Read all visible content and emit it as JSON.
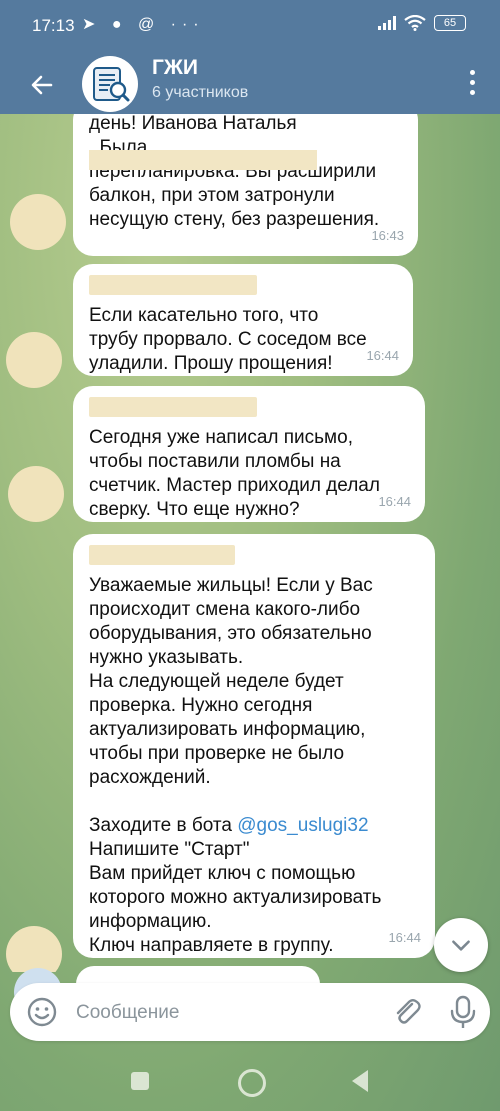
{
  "status_bar": {
    "time": "17:13",
    "notif_icons": "➤ ● @ ···",
    "battery": "65"
  },
  "header": {
    "title": "ГЖИ",
    "subtitle": "6 участников"
  },
  "messages": [
    {
      "text": "день! Иванова Наталья\n                                    , Была\nперепланировка. Вы расширили\nбалкон, при этом затронули\nнесущую стену, без разрешения.",
      "time": "16:43"
    },
    {
      "text": "Если касательно того, что\nтрубу прорвало. С соседом все\nуладили. Прошу прощения!",
      "time": "16:44"
    },
    {
      "text": "Сегодня уже написал письмо,\nчтобы поставили пломбы на\nсчетчик. Мастер приходил делал\nсверку. Что еще нужно?",
      "time": "16:44"
    },
    {
      "text_part1": "Уважаемые жильцы! Если у Вас\nпроисходит смена какого-либо\nоборудывания, это обязательно\nнужно указывать.\nНа следующей неделе будет\nпроверка. Нужно сегодня\nактуализировать информацию,\nчтобы при проверке не было\nрасхождений.\n\nЗаходите в бота ",
      "link": "@gos_uslugi32",
      "text_part2": "\nНапишите \"Старт\"\nВам прийдет ключ с помощью\nкоторого можно актуализировать\nинформацию.\nКлюч направляете в группу.",
      "time": "16:44"
    }
  ],
  "input": {
    "placeholder": "Сообщение"
  },
  "colors": {
    "header": "#557a9e",
    "link": "#3b8bd0"
  }
}
